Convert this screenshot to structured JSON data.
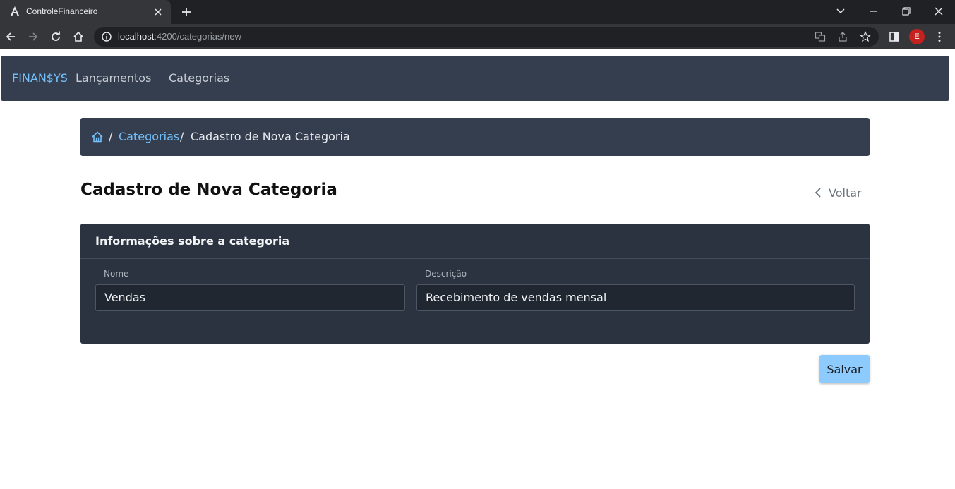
{
  "browser": {
    "tab_title": "ControleFinanceiro",
    "url_host": "localhost",
    "url_path": ":4200/categorias/new",
    "profile_initial": "E"
  },
  "navbar": {
    "brand": "FINAN$YS",
    "links": [
      "Lançamentos",
      "Categorias"
    ]
  },
  "breadcrumb": {
    "home_icon": "home-icon",
    "separator": "/",
    "link": "Categorias",
    "current": "Cadastro de Nova Categoria"
  },
  "page": {
    "title": "Cadastro de Nova Categoria",
    "back_label": "Voltar"
  },
  "card": {
    "title": "Informações sobre a categoria",
    "fields": [
      {
        "label": "Nome",
        "value": "Vendas"
      },
      {
        "label": "Descrição",
        "value": "Recebimento de vendas mensal"
      }
    ]
  },
  "actions": {
    "save_label": "Salvar"
  },
  "colors": {
    "navbar_bg": "#343e4e",
    "card_bg": "#2b3340",
    "accent_link": "#74c0fc",
    "save_button": "#8dcbff"
  }
}
